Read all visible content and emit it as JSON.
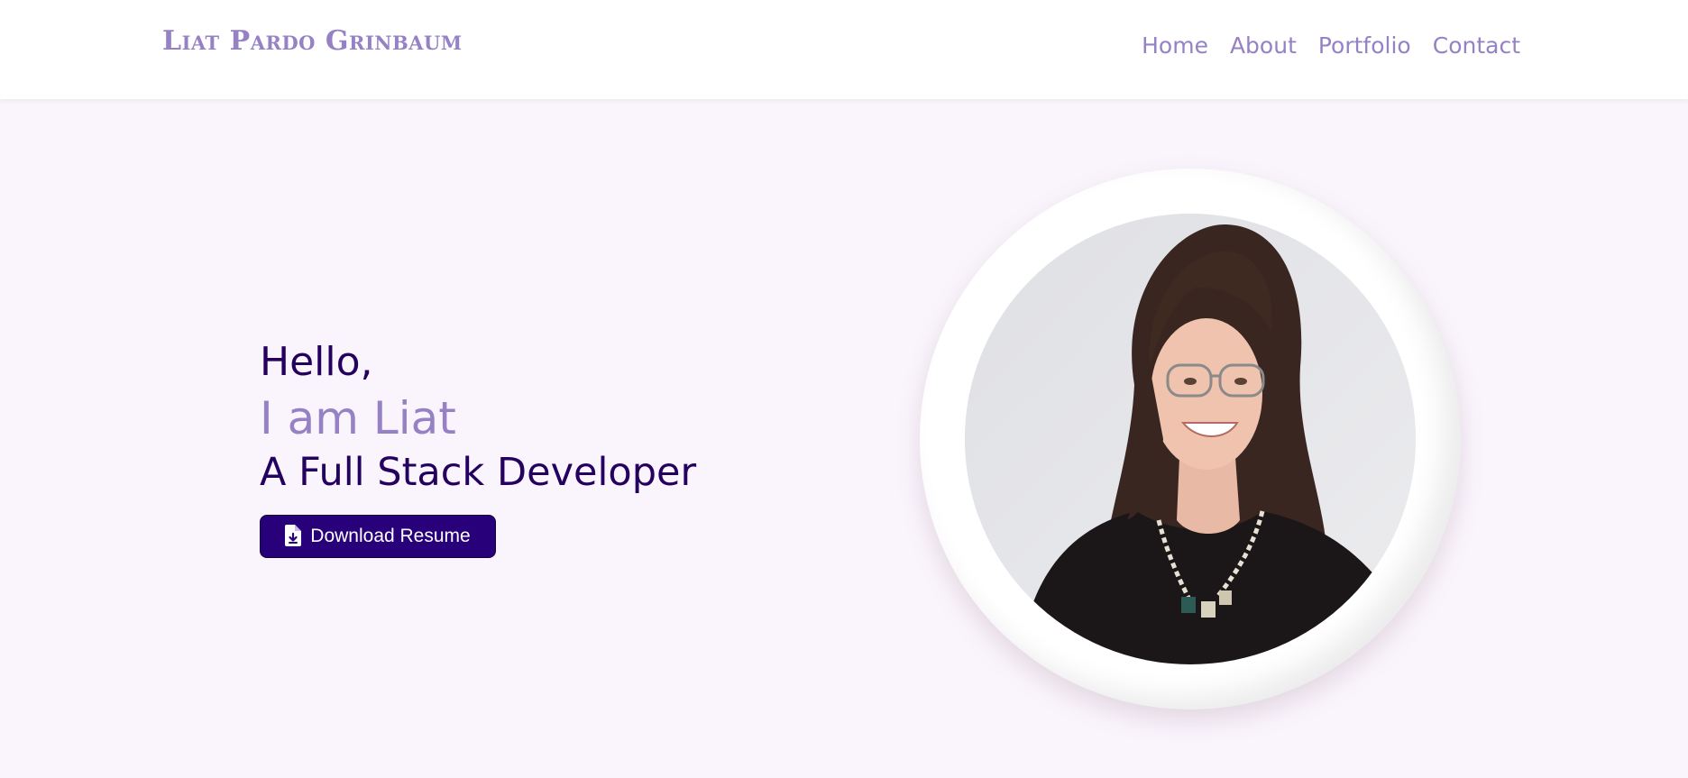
{
  "header": {
    "brand": "Liat Pardo Grinbaum",
    "nav": [
      "Home",
      "About",
      "Portfolio",
      "Contact"
    ]
  },
  "hero": {
    "greeting": "Hello,",
    "intro": "I am Liat",
    "role": "A Full Stack Developer",
    "resume_button": "Download Resume",
    "resume_icon": "file-download-icon"
  },
  "colors": {
    "accent": "#9581c4",
    "primary": "#24005f",
    "button": "#27007a",
    "background": "#faf5fc"
  }
}
